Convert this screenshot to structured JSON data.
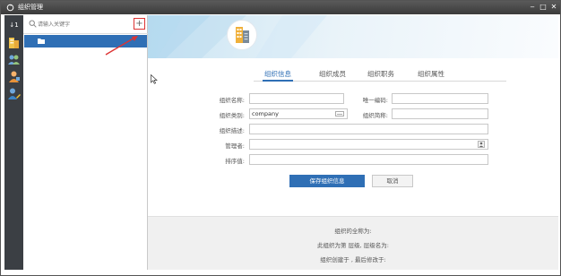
{
  "window": {
    "title": "组织管理",
    "controls": {
      "minimize": "‒",
      "maximize": "□",
      "close": "✕"
    }
  },
  "sidebar_rail": {
    "items": [
      {
        "icon": "sort-icon",
        "label": "↓1"
      },
      {
        "icon": "organization-icon"
      },
      {
        "icon": "users-icon"
      },
      {
        "icon": "user-group-icon"
      },
      {
        "icon": "user-edit-icon"
      }
    ]
  },
  "tree": {
    "search_placeholder": "请输入关键字",
    "add_label": "+"
  },
  "tabs": [
    {
      "label": "组织信息",
      "active": true
    },
    {
      "label": "组织成员",
      "active": false
    },
    {
      "label": "组织职务",
      "active": false
    },
    {
      "label": "组织属性",
      "active": false
    }
  ],
  "form": {
    "name_label": "组织名称:",
    "name_value": "",
    "code_label": "唯一编码:",
    "code_value": "",
    "type_label": "组织类别:",
    "type_value": "company",
    "short_label": "组织简称:",
    "short_value": "",
    "desc_label": "组织描述:",
    "desc_value": "",
    "manager_label": "管理者:",
    "manager_value": "",
    "order_label": "排序值:",
    "order_value": ""
  },
  "actions": {
    "save_label": "保存组织信息",
    "cancel_label": "取消"
  },
  "info": {
    "fullname_line": "组织的全称为:",
    "level_line": "此组织为第 层级, 层级名为:",
    "created_line": "组织创建于 , 最后修改于:"
  },
  "colors": {
    "accent": "#2f6fb5",
    "titlebar": "#4a4a4a",
    "rail": "#3b3f44",
    "highlight": "#dd3333"
  }
}
